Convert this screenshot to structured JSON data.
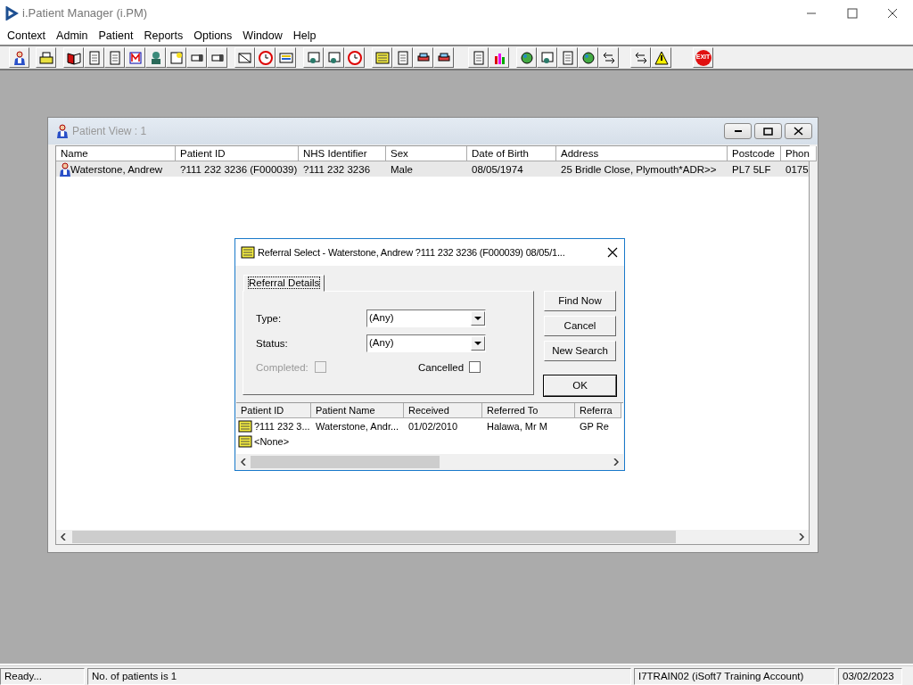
{
  "app": {
    "title": "i.Patient Manager (i.PM)"
  },
  "menu": [
    "Context",
    "Admin",
    "Patient",
    "Reports",
    "Options",
    "Window",
    "Help"
  ],
  "toolbar": {
    "exit_label": "EXIT"
  },
  "patient_view": {
    "title": "Patient View : 1",
    "columns": [
      "Name",
      "Patient ID",
      "NHS Identifier",
      "Sex",
      "Date of Birth",
      "Address",
      "Postcode",
      "Phon"
    ],
    "rows": [
      {
        "selected": true,
        "cells": [
          "Waterstone, Andrew",
          "?111 232 3236 (F000039)",
          "?111 232 3236",
          "Male",
          "08/05/1974",
          "25 Bridle Close, Plymouth*ADR>>",
          "PL7 5LF",
          "0175"
        ]
      }
    ]
  },
  "referral_dialog": {
    "title": "Referral Select - Waterstone, Andrew ?111 232 3236 (F000039) 08/05/1...",
    "tabs": [
      {
        "label": "Referral Details",
        "selected": true
      }
    ],
    "fields": [
      {
        "label": "Type:",
        "value": "(Any)"
      },
      {
        "label": "Status:",
        "value": "(Any)"
      }
    ],
    "checkboxes": [
      {
        "label": "Completed:",
        "checked": false,
        "disabled": true
      },
      {
        "label": "Cancelled",
        "checked": false,
        "disabled": false
      }
    ],
    "buttons": [
      {
        "label": "Find Now",
        "default": false
      },
      {
        "label": "Cancel",
        "default": false
      },
      {
        "label": "New Search",
        "default": false
      },
      {
        "label": "OK",
        "default": true
      }
    ],
    "list": {
      "columns": [
        "Patient ID",
        "Patient Name",
        "Received",
        "Referred To",
        "Referra"
      ],
      "rows": [
        {
          "cells": [
            "?111 232 3...",
            "Waterstone, Andr...",
            "01/02/2010",
            "Halawa, Mr M",
            "GP Re"
          ]
        },
        {
          "cells": [
            "<None>"
          ]
        }
      ]
    }
  },
  "status_bar": [
    "Ready...",
    "No. of patients is 1",
    "I7TRAIN02 (iSoft7 Training Account)",
    "03/02/2023"
  ]
}
